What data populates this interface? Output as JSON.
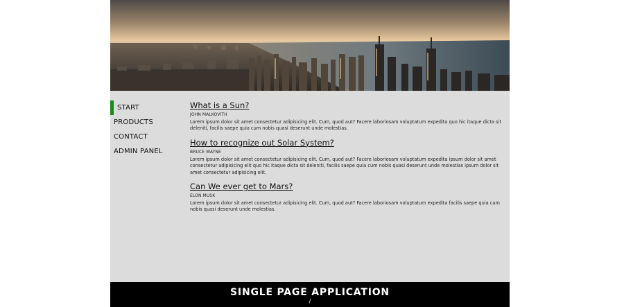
{
  "header": {
    "image": "city-skyline-image"
  },
  "sidebar": {
    "items": [
      {
        "label": "START",
        "active": true
      },
      {
        "label": "PRODUCTS",
        "active": false
      },
      {
        "label": "CONTACT",
        "active": false
      },
      {
        "label": "ADMIN PANEL",
        "active": false
      }
    ]
  },
  "articles": [
    {
      "title": "What is a Sun?",
      "author": "JOHN MALKOVITH",
      "body": "Lorem ipsum dolor sit amet consectetur adipisicing elit. Cum, quod aut? Facere laboriosam voluptatum expedita quo hic itaque dicta sit deleniti, facilis saepe quia cum nobis quasi deserunt unde molestias."
    },
    {
      "title": "How to recognize out Solar System?",
      "author": "BRUCE WAYNE",
      "body": "Lorem ipsum dolor sit amet consectetur adipisicing elit. Cum, quod aut? Facere laboriosam voluptatum expedita ipsum dolor sit amet consectetur adipisicing elit quo hic itaque dicta sit deleniti, facilis saepe quia cum nobis quasi deserunt unde molestias ipsum dolor sit amet consectetur adipisicing elit."
    },
    {
      "title": "Can We ever get to Mars?",
      "author": "ELON MUSK",
      "body": "Lorem ipsum dolor sit amet consectetur adipisicing elit. Cum, quod aut? Facere laboriosam voluptatum expedita facilis saepe quia cum nobis quasi deserunt unde molestias."
    }
  ],
  "footer": {
    "title": "SINGLE PAGE APPLICATION",
    "path": "/"
  },
  "colors": {
    "page_background": "#dcdcdc",
    "active_indicator": "#1a8a1a",
    "footer_background": "#000000"
  }
}
